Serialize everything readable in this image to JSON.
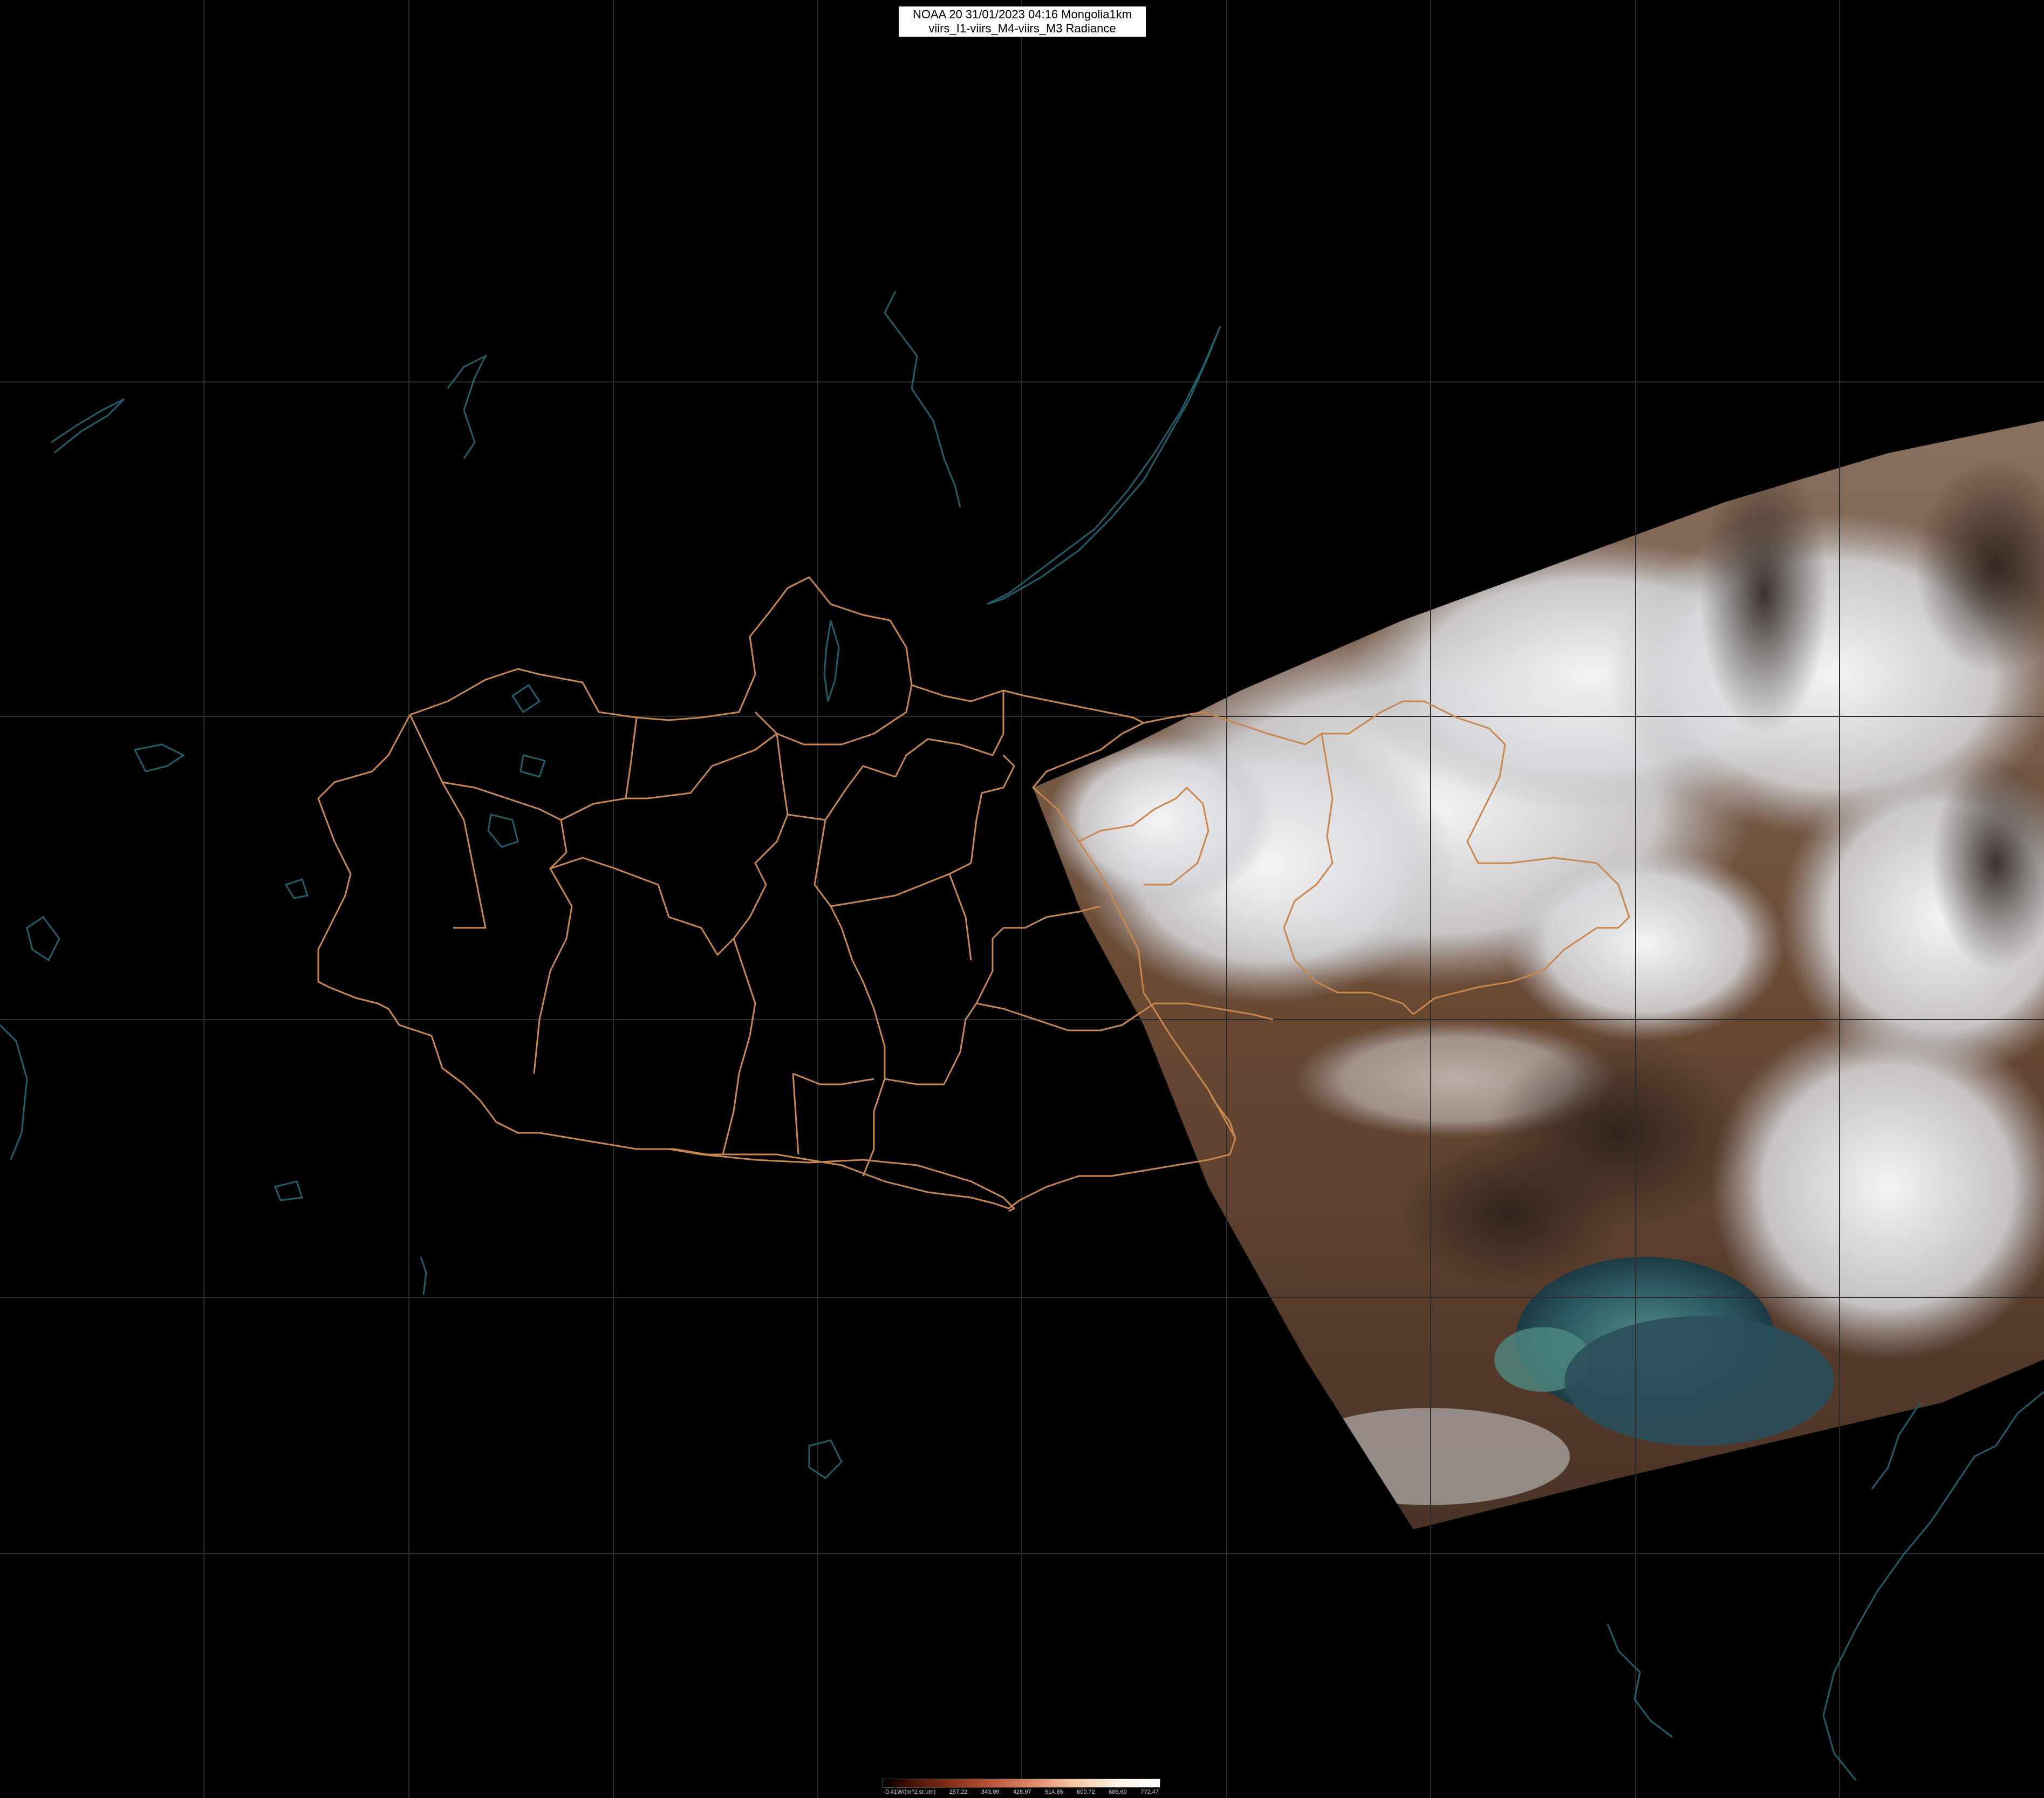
{
  "header": {
    "line1": "NOAA 20 31/01/2023 04:16 Mongolia1km",
    "line2": "viirs_I1-viirs_M4-viirs_M3 Radiance"
  },
  "legend": {
    "unit_label": "-0.41W/(m^2.sr.um)",
    "ticks": [
      "257.22",
      "343.09",
      "428.97",
      "514.85",
      "600.72",
      "686.60",
      "772.47"
    ]
  },
  "colors": {
    "border": "#c9874e",
    "coast": "#1f5f6a",
    "grid": "#2c2c2c",
    "background": "#000000"
  }
}
